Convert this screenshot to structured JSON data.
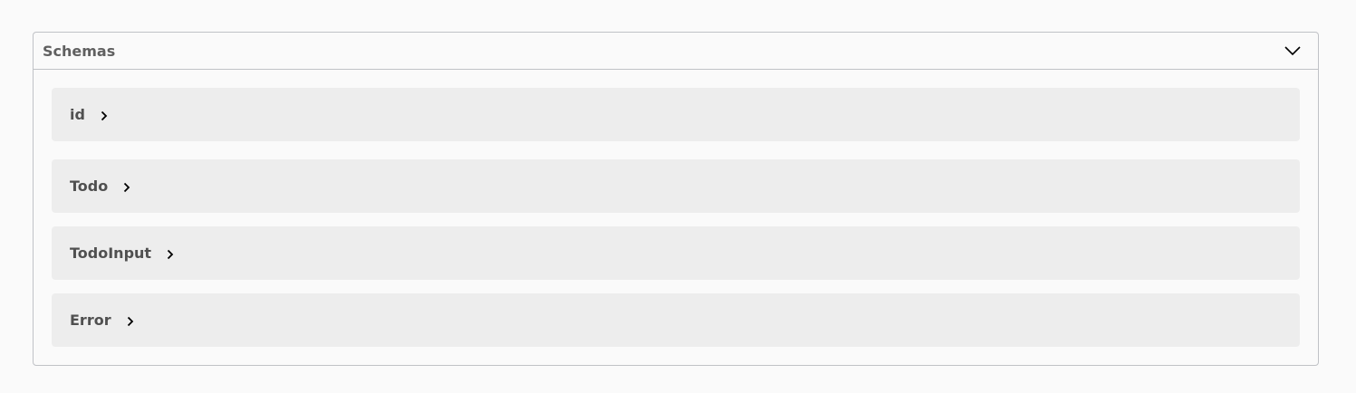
{
  "schemas": {
    "title": "Schemas",
    "expanded_icon": "chevron-down-icon",
    "models": [
      {
        "name": "id",
        "icon": "chevron-right-icon"
      },
      {
        "name": "Todo",
        "icon": "chevron-right-icon"
      },
      {
        "name": "TodoInput",
        "icon": "chevron-right-icon"
      },
      {
        "name": "Error",
        "icon": "chevron-right-icon"
      }
    ]
  }
}
